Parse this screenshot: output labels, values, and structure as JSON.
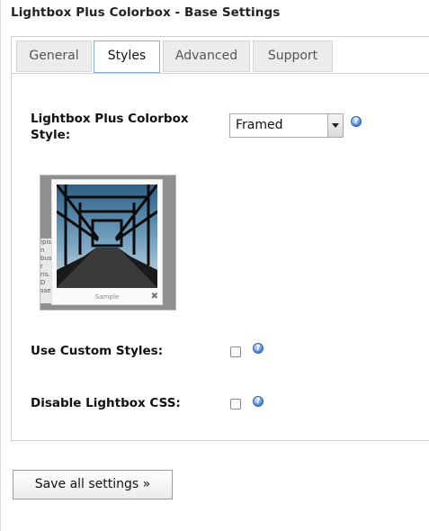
{
  "page": {
    "title": "Lightbox Plus Colorbox - Base Settings"
  },
  "tabs": [
    {
      "label": "General",
      "active": false
    },
    {
      "label": "Styles",
      "active": true
    },
    {
      "label": "Advanced",
      "active": false
    },
    {
      "label": "Support",
      "active": false
    }
  ],
  "styles": {
    "style_label_line1": "Lightbox Plus Colorbox",
    "style_label_line2": "Style:",
    "style_value": "Framed",
    "preview_caption": "Sample",
    "preview_close": "✖",
    "preview_bgtext": "ipis n \nbus\nr\nris. D\nsset",
    "custom_styles_label": "Use Custom Styles:",
    "custom_styles_checked": false,
    "disable_css_label": "Disable Lightbox CSS:",
    "disable_css_checked": false,
    "help_glyph": "?"
  },
  "actions": {
    "save_label": "Save all settings »"
  },
  "icons": {
    "help": "help-question-icon",
    "dropdown": "chevron-down-icon",
    "close": "close-icon"
  },
  "colors": {
    "help_icon": "#4a86d6",
    "active_tab_border": "#8fb0d6"
  }
}
